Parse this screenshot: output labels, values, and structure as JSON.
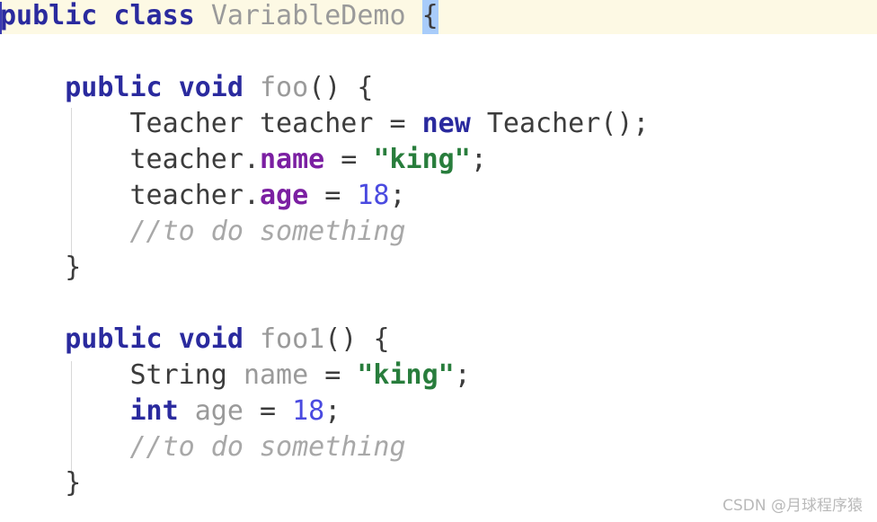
{
  "editor": {
    "language": "java",
    "background_color": "#ffffff",
    "caret_line_color": "#fdf9e4",
    "brace_match_color": "#a8ccfa",
    "indent_guide_color": "#d8d8d8",
    "colors": {
      "keyword": "#2a2a9e",
      "identifier": "#3c3c3c",
      "dimmed": "#9a9a9a",
      "field": "#7b1fa2",
      "string": "#287d3c",
      "number": "#4a4ae0",
      "comment": "#a8a8a8"
    }
  },
  "code": {
    "line1": {
      "kw_public": "public",
      "sp1": " ",
      "kw_class": "class",
      "sp2": " ",
      "class_name": "VariableDemo",
      "sp3": " ",
      "brace_open": "{"
    },
    "line2": {
      "text": ""
    },
    "line3": {
      "indent": "    ",
      "kw_public": "public",
      "sp1": " ",
      "kw_void": "void",
      "sp2": " ",
      "method_name": "foo",
      "parens": "() ",
      "brace_open": "{"
    },
    "line4": {
      "indent": "        ",
      "type": "Teacher",
      "sp1": " ",
      "var": "teacher",
      "assign": " = ",
      "kw_new": "new",
      "sp2": " ",
      "ctor": "Teacher();"
    },
    "line5": {
      "indent": "        ",
      "var": "teacher",
      "dot": ".",
      "field": "name",
      "assign": " = ",
      "string": "\"king\"",
      "semi": ";"
    },
    "line6": {
      "indent": "        ",
      "var": "teacher",
      "dot": ".",
      "field": "age",
      "assign": " = ",
      "number": "18",
      "semi": ";"
    },
    "line7": {
      "indent": "        ",
      "comment": "//to do something"
    },
    "line8": {
      "indent": "    ",
      "brace_close": "}"
    },
    "line9": {
      "text": ""
    },
    "line10": {
      "indent": "    ",
      "kw_public": "public",
      "sp1": " ",
      "kw_void": "void",
      "sp2": " ",
      "method_name": "foo1",
      "parens": "() ",
      "brace_open": "{"
    },
    "line11": {
      "indent": "        ",
      "type": "String",
      "sp1": " ",
      "var": "name",
      "assign": " = ",
      "string": "\"king\"",
      "semi": ";"
    },
    "line12": {
      "indent": "        ",
      "kw_int": "int",
      "sp1": " ",
      "var": "age",
      "assign": " = ",
      "number": "18",
      "semi": ";"
    },
    "line13": {
      "indent": "        ",
      "comment": "//to do something"
    },
    "line14": {
      "indent": "    ",
      "brace_close": "}"
    }
  },
  "watermark": {
    "text": "CSDN @月球程序猿"
  }
}
